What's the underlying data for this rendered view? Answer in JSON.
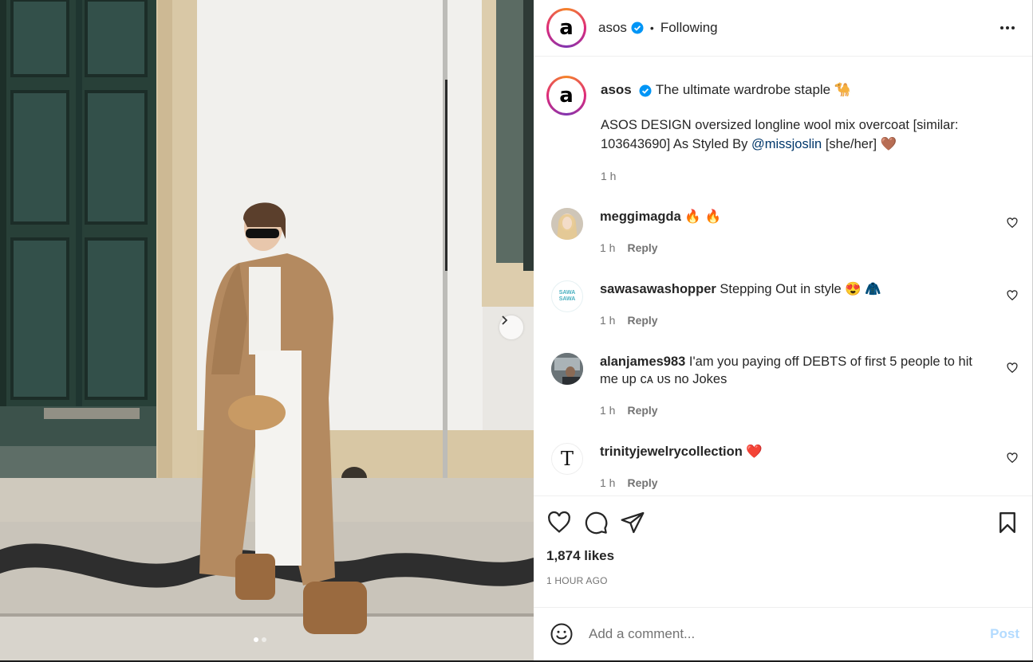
{
  "post": {
    "username": "asos",
    "following_label": "Following",
    "avatar_letter": "a",
    "caption_title": "The ultimate wardrobe staple 🐪",
    "caption_text_1": "ASOS DESIGN oversized longline wool mix overcoat [similar: 103643690] As Styled By ",
    "caption_mention": "@missjoslin",
    "caption_text_2": " [she/her] 🤎",
    "caption_time": "1 h",
    "likes": "1,874 likes",
    "posted": "1 HOUR AGO"
  },
  "comments": [
    {
      "user": "meggimagda",
      "text": " 🔥 🔥",
      "time": "1 h",
      "reply": "Reply"
    },
    {
      "user": "sawasawashopper",
      "text": " Stepping Out in style 😍 🧥",
      "time": "1 h",
      "reply": "Reply",
      "avatar_text": "SAWA SAWA"
    },
    {
      "user": "alanjames983",
      "text": " I'am you paying off DEBTS of first 5 people to hit me up ᴄᴀ ᴜs no Jokes",
      "time": "1 h",
      "reply": "Reply"
    },
    {
      "user": "trinityjewelrycollection",
      "text": " ❤️",
      "time": "1 h",
      "reply": "Reply",
      "avatar_text": "T"
    }
  ],
  "composer": {
    "placeholder": "Add a comment...",
    "post_label": "Post"
  },
  "colors": {
    "verified": "#0095f6",
    "post_disabled": "#b3dbff",
    "secondary_text": "#737373",
    "mention": "#00376b"
  },
  "icons": [
    "verified-badge-icon",
    "more-options-icon",
    "heart-icon",
    "comment-icon",
    "share-icon",
    "bookmark-icon",
    "emoji-icon",
    "chevron-right-icon"
  ],
  "carousel": {
    "slides": 2,
    "active": 1
  }
}
